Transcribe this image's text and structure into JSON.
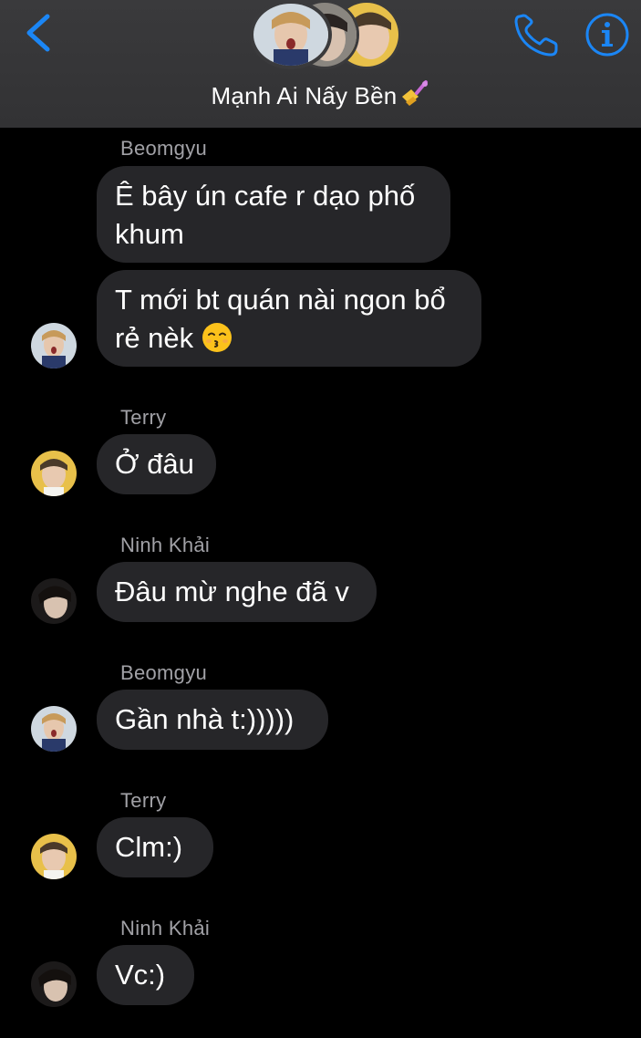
{
  "header": {
    "title": "Mạnh Ai Nấy Bền",
    "title_emoji": "nail-polish-emoji",
    "accent_color": "#1b86f5",
    "icons": [
      "back-chevron-icon",
      "phone-icon",
      "info-icon"
    ]
  },
  "messages": [
    {
      "sender": "Beomgyu",
      "bubbles": [
        "Ê bây ún cafe r dạo phố khum",
        "T mới bt quán nài ngon bổ rẻ nèk"
      ],
      "emoji": "kissing-face-emoji"
    },
    {
      "sender": "Terry",
      "bubbles": [
        "Ở đâu"
      ]
    },
    {
      "sender": "Ninh  Khải",
      "bubbles": [
        "Đâu mừ nghe đã v"
      ]
    },
    {
      "sender": "Beomgyu",
      "bubbles": [
        "Gần nhà t:)))))"
      ]
    },
    {
      "sender": "Terry",
      "bubbles": [
        "Clm:)"
      ]
    },
    {
      "sender": "Ninh  Khải",
      "bubbles": [
        "Vc:)"
      ]
    }
  ]
}
